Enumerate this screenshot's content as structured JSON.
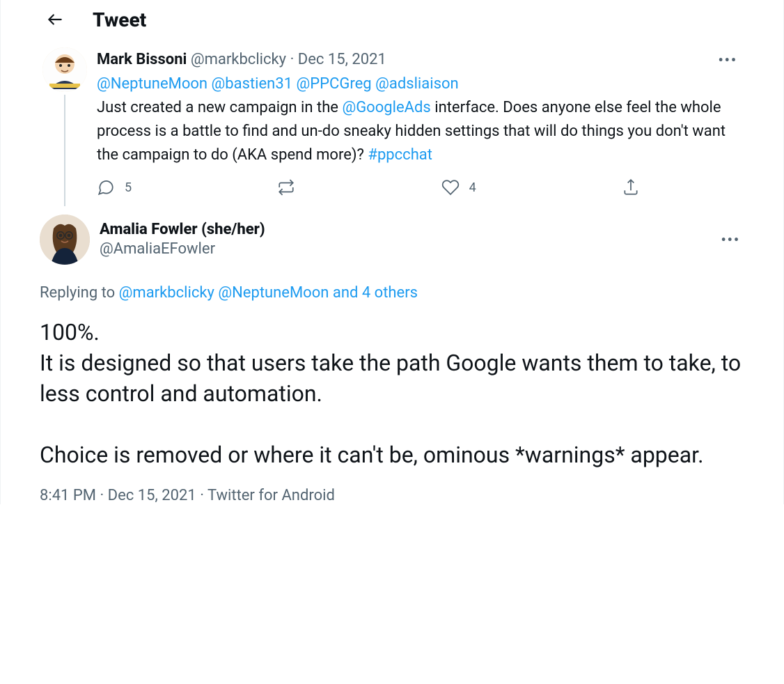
{
  "header": {
    "title": "Tweet"
  },
  "parent": {
    "name": "Mark Bissoni",
    "handle": "@markbclicky",
    "date": "Dec 15, 2021",
    "mentions": [
      "@NeptuneMoon",
      "@bastien31",
      "@PPCGreg",
      "@adsliaison"
    ],
    "text_pre": " Just created a new campaign in the ",
    "inline_link": "@GoogleAds",
    "text_mid": " interface. Does anyone else feel the whole process is a battle to find and un-do sneaky hidden settings that will do things you don't want the campaign to do (AKA spend more)? ",
    "hashtag": "#ppcchat",
    "reply_count": "5",
    "like_count": "4"
  },
  "main": {
    "name": "Amalia Fowler (she/her)",
    "handle": "@AmaliaEFowler",
    "replying_prefix": "Replying to ",
    "replying_mentions": "@markbclicky @NeptuneMoon",
    "replying_suffix": " and 4 others",
    "body": "100%.\nIt is designed so that users take the path Google wants them to take, to less control and automation. \n\nChoice is removed or where it can't be, ominous *warnings* appear.",
    "time": "8:41 PM",
    "date": "Dec 15, 2021",
    "source": "Twitter for Android"
  }
}
